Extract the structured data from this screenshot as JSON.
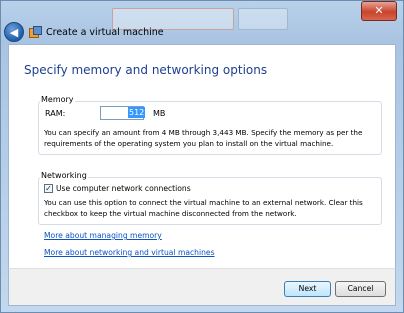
{
  "window": {
    "title": "Create a virtual machine",
    "close_glyph": "✕",
    "back_glyph": "◀"
  },
  "page": {
    "heading": "Specify memory and networking options"
  },
  "memory": {
    "group_label": "Memory",
    "ram_label": "RAM:",
    "ram_value": "512",
    "ram_unit": "MB",
    "description": "You can specify an amount from 4 MB through 3,443 MB. Specify the memory as per the requirements of the operating system you plan to install on the virtual machine."
  },
  "networking": {
    "group_label": "Networking",
    "checkbox_checked": true,
    "checkbox_glyph": "✓",
    "checkbox_label": "Use computer network connections",
    "description": "You can use this option to connect the virtual machine to an external network. Clear this checkbox to keep the virtual machine disconnected from the network."
  },
  "links": {
    "managing_memory": "More about managing memory",
    "networking_vms": "More about networking and virtual machines"
  },
  "buttons": {
    "next": "Next",
    "cancel": "Cancel"
  },
  "colors": {
    "heading": "#1e3f8f",
    "link": "#0b52c4",
    "selection": "#3399ff",
    "close_button": "#c8432b"
  },
  "icons": {
    "back": "back-arrow-icon",
    "app": "virtual-machine-icon",
    "close": "close-icon",
    "checkbox": "checkmark-icon"
  }
}
